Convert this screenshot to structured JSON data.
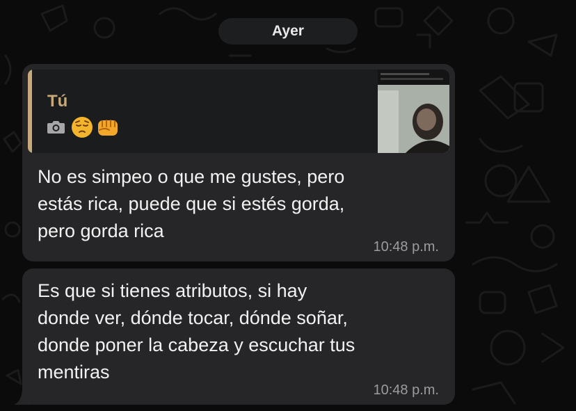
{
  "chat": {
    "date_separator": "Ayer",
    "messages": [
      {
        "reply_to": {
          "author": "Tú",
          "attachment_icon": "camera-icon",
          "emojis": [
            "pensive-face-emoji",
            "oncoming-fist-emoji"
          ]
        },
        "lines": [
          "No es simpeo o que me gustes, pero",
          "estás rica, puede que si estés gorda,",
          "pero gorda rica"
        ],
        "time": "10:48 p.m."
      },
      {
        "lines": [
          "Es que si tienes atributos, si hay",
          "donde ver, dónde tocar, dónde soñar,",
          "donde poner la cabeza y escuchar tus",
          "mentiras"
        ],
        "time": "10:48 p.m."
      }
    ]
  },
  "colors": {
    "background": "#0b0b0b",
    "bubble": "#262628",
    "quote_background": "#1b1c1e",
    "quote_accent": "#c8a97a",
    "text": "#f2f2f2",
    "time": "#9c9c9e"
  }
}
